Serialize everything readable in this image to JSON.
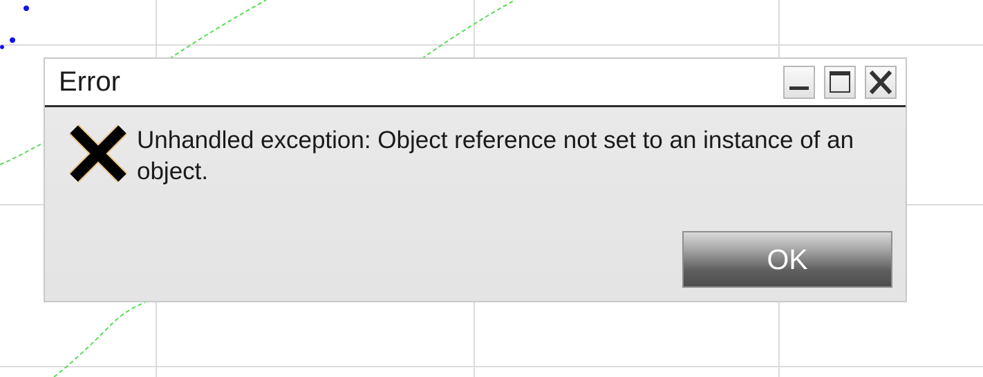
{
  "dialog": {
    "title": "Error",
    "message": "Unhandled exception: Object reference not set to an instance of an object.",
    "icon": "error-x-icon",
    "ok_label": "OK",
    "window_controls": [
      "minimize-icon",
      "maximize-icon",
      "close-icon"
    ]
  },
  "colors": {
    "plot_points": "#1010ee",
    "plot_line": "#55dd55",
    "grid": "#dcdcdc"
  }
}
